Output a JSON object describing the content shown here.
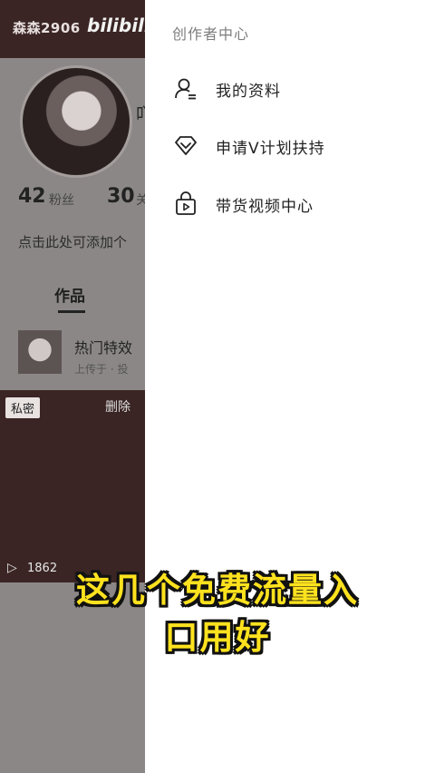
{
  "background": {
    "watermark": "森森2906",
    "logo": "bilibili",
    "name_char": "吖",
    "stats": [
      {
        "num": "42",
        "label": "粉丝"
      },
      {
        "num": "30",
        "label": "关"
      }
    ],
    "signature": "点击此处可添加个",
    "tab": "作品",
    "row": {
      "title": "热门特效",
      "subtitle": "上传于 · 投"
    },
    "video": {
      "private_badge": "私密",
      "delete": "删除",
      "play_count": "1862"
    }
  },
  "drawer": {
    "title": "创作者中心",
    "items": [
      {
        "label": "我的资料",
        "icon": "profile-icon"
      },
      {
        "label": "申请V计划扶持",
        "icon": "heart-badge-icon"
      },
      {
        "label": "带货视频中心",
        "icon": "shopping-bag-icon"
      }
    ]
  },
  "caption": {
    "line1": "这几个免费流量入",
    "line2": "口用好",
    "color": "#ffe21e"
  }
}
